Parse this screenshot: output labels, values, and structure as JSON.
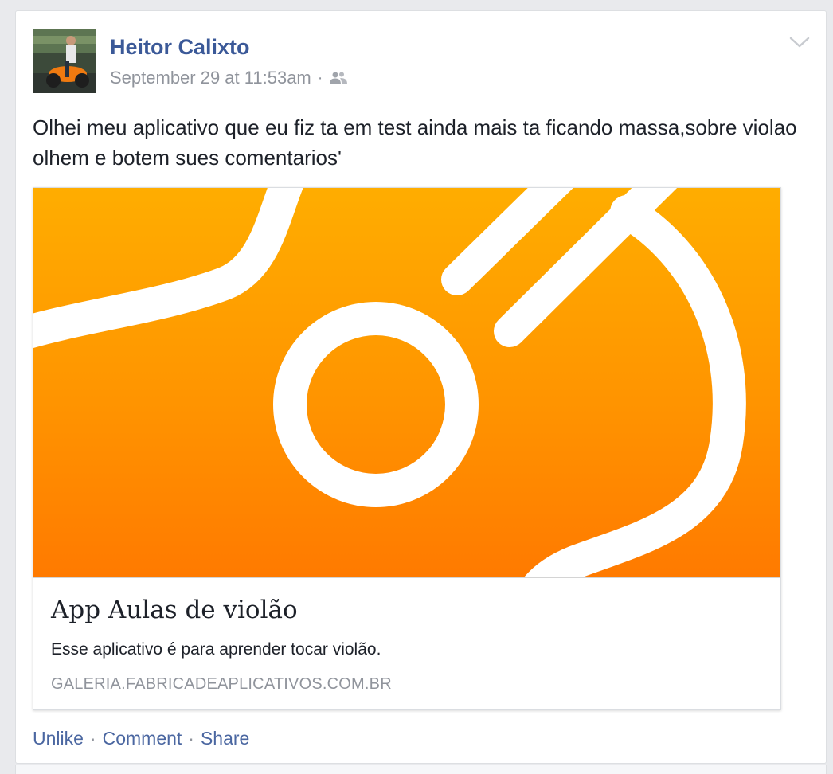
{
  "post": {
    "author": "Heitor Calixto",
    "timestamp": "September 29 at 11:53am",
    "meta_separator": "·",
    "audience_icon": "friends-icon",
    "menu_icon": "chevron-down-icon",
    "text": "Olhei meu aplicativo que eu fiz ta em test ainda mais ta ficando massa,sobre violao olhem e botem sues comentarios'"
  },
  "link_preview": {
    "image_icon": "guitar-logo",
    "title": "App Aulas de violão",
    "description": "Esse aplicativo é para aprender tocar violão.",
    "domain": "GALERIA.FABRICADEAPLICATIVOS.COM.BR"
  },
  "actions": {
    "unlike": "Unlike",
    "comment": "Comment",
    "share": "Share",
    "separator": "·"
  },
  "colors": {
    "link_blue": "#3b5998",
    "action_blue": "#4b67a1",
    "meta_gray": "#90949c",
    "preview_orange_top": "#ffad00",
    "preview_orange_bottom": "#ff7a00"
  }
}
